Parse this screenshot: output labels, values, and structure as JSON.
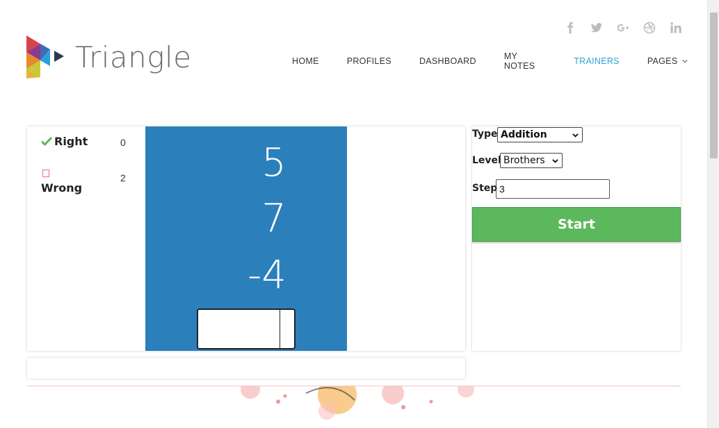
{
  "header": {
    "brand": "Triangle",
    "nav": [
      {
        "label": "HOME"
      },
      {
        "label": "PROFILES"
      },
      {
        "label": "DASHBOARD"
      },
      {
        "label": "MY NOTES"
      },
      {
        "label": "TRAINERS",
        "active": true
      },
      {
        "label": "PAGES"
      }
    ],
    "social_icons": [
      "facebook-icon",
      "twitter-icon",
      "google-plus-icon",
      "dribbble-icon",
      "linkedin-icon"
    ],
    "accent_color": "#2ea3d6"
  },
  "score": {
    "right_label": "Right",
    "right_count": "0",
    "wrong_label": "Wrong",
    "wrong_count": "2"
  },
  "trainer": {
    "numbers": [
      "5",
      "7",
      "-4"
    ],
    "answer_value": "",
    "box_color": "#2b7fbb"
  },
  "controls": {
    "type_label": "Type",
    "type_value": "Addition",
    "level_label": "Level",
    "level_value": "Brothers",
    "step_label": "Step",
    "step_value": "3",
    "start_label": "Start",
    "start_color": "#5cb85c"
  }
}
